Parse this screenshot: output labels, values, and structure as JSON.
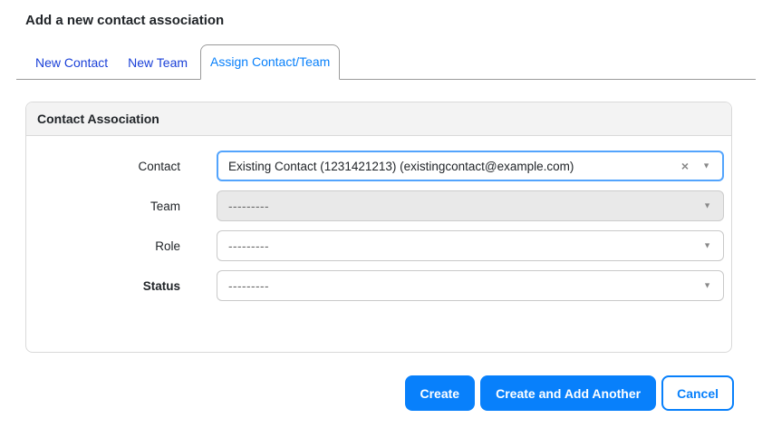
{
  "page": {
    "title": "Add a new contact association"
  },
  "tabs": [
    {
      "label": "New Contact",
      "active": false
    },
    {
      "label": "New Team",
      "active": false
    },
    {
      "label": "Assign Contact/Team",
      "active": true
    }
  ],
  "panel": {
    "title": "Contact Association",
    "fields": [
      {
        "label": "Contact",
        "value": "Existing Contact (1231421213) (existingcontact@example.com)",
        "type": "select2",
        "state": "focused",
        "clearable": true,
        "required": false
      },
      {
        "label": "Team",
        "value": "---------",
        "type": "select",
        "state": "disabled",
        "required": false
      },
      {
        "label": "Role",
        "value": "---------",
        "type": "select",
        "state": "normal",
        "required": false
      },
      {
        "label": "Status",
        "value": "---------",
        "type": "select",
        "state": "normal",
        "required": true
      }
    ]
  },
  "buttons": {
    "create": "Create",
    "create_add_another": "Create and Add Another",
    "cancel": "Cancel"
  },
  "icons": {
    "clear": "×",
    "caret": "▼"
  },
  "colors": {
    "primary": "#0880fb",
    "link-blue": "#1b41d8",
    "focus-border": "#53a4fd",
    "panel-header-bg": "#f3f3f3",
    "disabled-bg": "#e9e9e9"
  }
}
